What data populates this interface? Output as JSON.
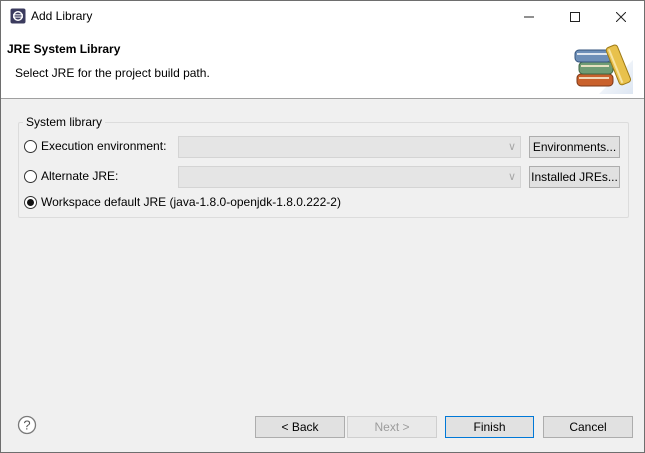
{
  "window": {
    "title": "Add Library"
  },
  "banner": {
    "title": "JRE System Library",
    "description": "Select JRE for the project build path."
  },
  "group": {
    "label": "System library",
    "options": [
      {
        "label": "Execution environment:",
        "checked": false,
        "button": "Environments..."
      },
      {
        "label": "Alternate JRE:",
        "checked": false,
        "button": "Installed JREs..."
      },
      {
        "label": "Workspace default JRE (java-1.8.0-openjdk-1.8.0.222-2)",
        "checked": true
      }
    ]
  },
  "footer": {
    "back": "< Back",
    "next": "Next >",
    "finish": "Finish",
    "cancel": "Cancel"
  },
  "colors": {
    "accent": "#0078d7",
    "background": "#f0f0f0"
  }
}
